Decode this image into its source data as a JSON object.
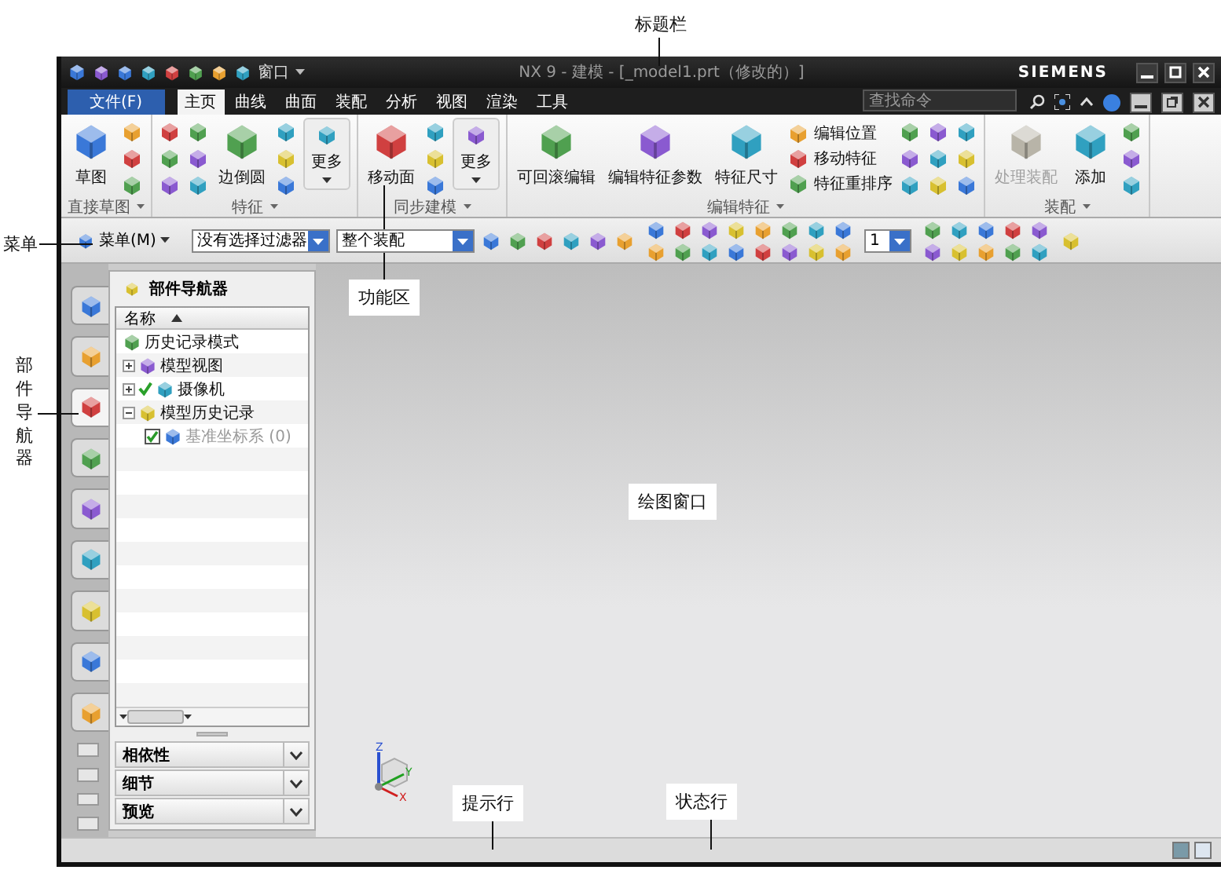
{
  "annotations": [
    {
      "text": "标题栏"
    },
    {
      "text": "菜单"
    },
    {
      "text": "功能区"
    },
    {
      "text": "部件导航器"
    },
    {
      "text": "绘图窗口"
    },
    {
      "text": "提示行"
    },
    {
      "text": "状态行"
    }
  ],
  "window": {
    "title": "NX 9 - 建模 - [_model1.prt（修改的）]",
    "brand": "SIEMENS",
    "quick_menu": "窗口"
  },
  "menu_tabs": [
    {
      "label": "文件(F)",
      "kind": "file",
      "selected": false
    },
    {
      "label": "主页",
      "kind": "tab",
      "selected": true
    },
    {
      "label": "曲线",
      "kind": "tab",
      "selected": false
    },
    {
      "label": "曲面",
      "kind": "tab",
      "selected": false
    },
    {
      "label": "装配",
      "kind": "tab",
      "selected": false
    },
    {
      "label": "分析",
      "kind": "tab",
      "selected": false
    },
    {
      "label": "视图",
      "kind": "tab",
      "selected": false
    },
    {
      "label": "渲染",
      "kind": "tab",
      "selected": false
    },
    {
      "label": "工具",
      "kind": "tab",
      "selected": false
    }
  ],
  "search": {
    "placeholder": "查找命令"
  },
  "ribbon_groups": [
    {
      "title": "直接草图",
      "items": [
        {
          "kind": "large",
          "label": "草图",
          "disabled": false
        },
        {
          "kind": "icons"
        }
      ]
    },
    {
      "title": "特征",
      "items": [
        {
          "kind": "icons"
        },
        {
          "kind": "icons"
        },
        {
          "kind": "large",
          "label": "边倒圆",
          "disabled": false
        },
        {
          "kind": "icons"
        },
        {
          "kind": "more",
          "label": "更多"
        }
      ]
    },
    {
      "title": "同步建模",
      "items": [
        {
          "kind": "large",
          "label": "移动面",
          "disabled": false
        },
        {
          "kind": "icons"
        },
        {
          "kind": "more",
          "label": "更多"
        }
      ]
    },
    {
      "title": "编辑特征",
      "items": [
        {
          "kind": "large",
          "label": "可回滚编辑",
          "disabled": false
        },
        {
          "kind": "large",
          "label": "编辑特征参数",
          "disabled": false
        },
        {
          "kind": "large",
          "label": "特征尺寸",
          "disabled": false
        },
        {
          "kind": "list",
          "entries": [
            "编辑位置",
            "移动特征",
            "特征重排序"
          ]
        },
        {
          "kind": "icons"
        },
        {
          "kind": "icons"
        },
        {
          "kind": "icons"
        }
      ]
    },
    {
      "title": "装配",
      "items": [
        {
          "kind": "large",
          "label": "处理装配",
          "disabled": true
        },
        {
          "kind": "large",
          "label": "添加",
          "disabled": false
        },
        {
          "kind": "icons"
        }
      ]
    }
  ],
  "toolbar": {
    "menu_button": "菜单(M)",
    "selection_filter": "没有选择过滤器",
    "scope": "整个装配",
    "layer": "1"
  },
  "resource_tabs": [
    {
      "selected": false
    },
    {
      "selected": false
    },
    {
      "selected": true
    },
    {
      "selected": false
    },
    {
      "selected": false
    },
    {
      "selected": false
    },
    {
      "selected": false
    },
    {
      "selected": false
    },
    {
      "selected": false
    }
  ],
  "navigator": {
    "title": "部件导航器",
    "column": "名称",
    "tree": [
      {
        "label": "历史记录模式",
        "kind": "mode"
      },
      {
        "label": "模型视图",
        "kind": "node",
        "expanded": false,
        "checked": false
      },
      {
        "label": "摄像机",
        "kind": "node",
        "expanded": false,
        "checked": true
      },
      {
        "label": "模型历史记录",
        "kind": "node",
        "expanded": true,
        "checked": false,
        "children": [
          {
            "label": "基准坐标系 (0)",
            "kind": "leaf",
            "checked": true,
            "disabled": true
          }
        ]
      }
    ],
    "panels": [
      {
        "label": "相依性",
        "expanded": false
      },
      {
        "label": "细节",
        "expanded": false
      },
      {
        "label": "预览",
        "expanded": false
      }
    ]
  },
  "triad": {
    "z": "Z",
    "y": "Y",
    "x": "X"
  }
}
